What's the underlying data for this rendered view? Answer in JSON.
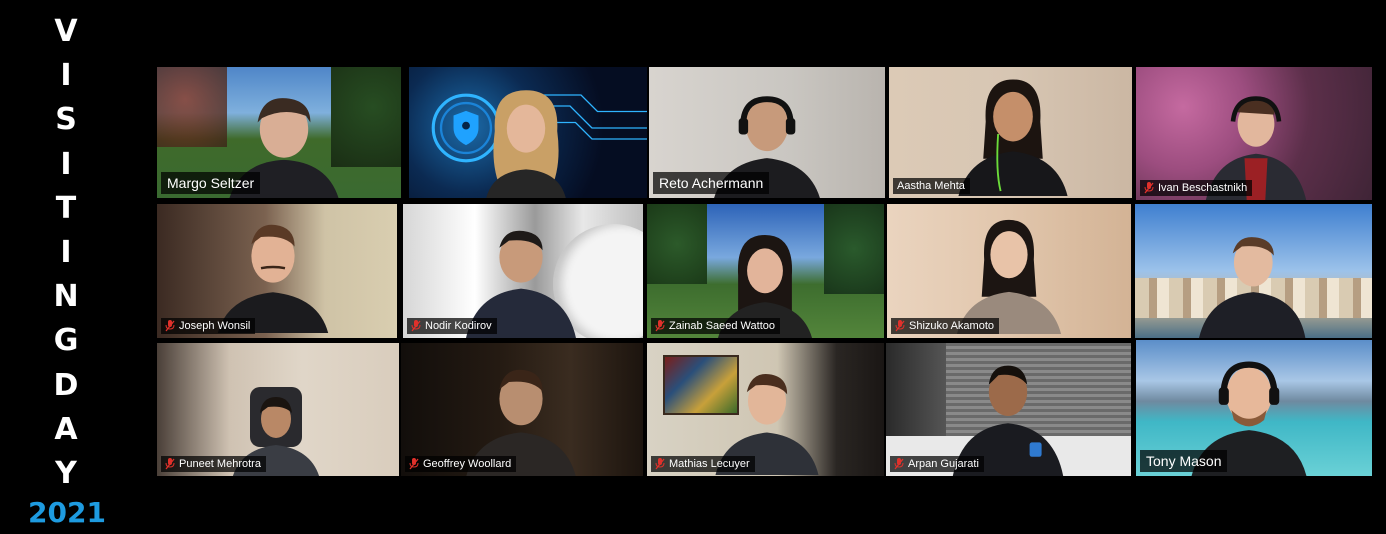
{
  "sidebar": {
    "letters": [
      "V",
      "I",
      "S",
      "I",
      "T",
      "I",
      "N",
      "G",
      "D",
      "A",
      "Y"
    ],
    "year": "2021"
  },
  "colors": {
    "year": "#1e9be0",
    "active_speaker_border": "#d6e85a",
    "mute_icon": "#e0312b"
  },
  "participants": [
    {
      "name": "Margo Seltzer",
      "muted": false
    },
    {
      "name": "",
      "muted": false
    },
    {
      "name": "Reto Achermann",
      "muted": false
    },
    {
      "name": "Aastha Mehta",
      "muted": false,
      "active": true
    },
    {
      "name": "Ivan Beschastnikh",
      "muted": true
    },
    {
      "name": "Joseph Wonsil",
      "muted": true
    },
    {
      "name": "Nodir Kodirov",
      "muted": true
    },
    {
      "name": "Zainab Saeed Wattoo",
      "muted": true
    },
    {
      "name": "Shizuko Akamoto",
      "muted": true
    },
    {
      "name": "",
      "muted": false
    },
    {
      "name": "Puneet Mehrotra",
      "muted": true
    },
    {
      "name": "Geoffrey Woollard",
      "muted": true
    },
    {
      "name": "Mathias Lecuyer",
      "muted": true
    },
    {
      "name": "Arpan Gujarati",
      "muted": true
    },
    {
      "name": "Tony Mason",
      "muted": false
    }
  ]
}
